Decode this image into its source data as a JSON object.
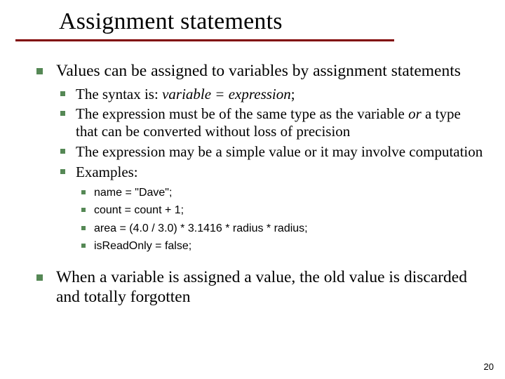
{
  "title": "Assignment statements",
  "bullets": {
    "b1": "Values can be assigned to variables by assignment statements",
    "sub": {
      "s1_a": "The syntax is:  ",
      "s1_b": "variable = expression",
      "s1_c": ";",
      "s2_a": "The expression must be of the same type as the variable ",
      "s2_b": "or",
      "s2_c": " a type that can be converted without loss of precision",
      "s3": "The expression may be a simple value or it may involve computation",
      "s4": "Examples:",
      "ex": {
        "e1": "name = \"Dave\";",
        "e2": "count = count + 1;",
        "e3": "area = (4.0 / 3.0) * 3.1416 * radius * radius;",
        "e4": "isReadOnly = false;"
      }
    },
    "b2": "When a variable is assigned a value, the old value is discarded and totally forgotten"
  },
  "page_number": "20"
}
